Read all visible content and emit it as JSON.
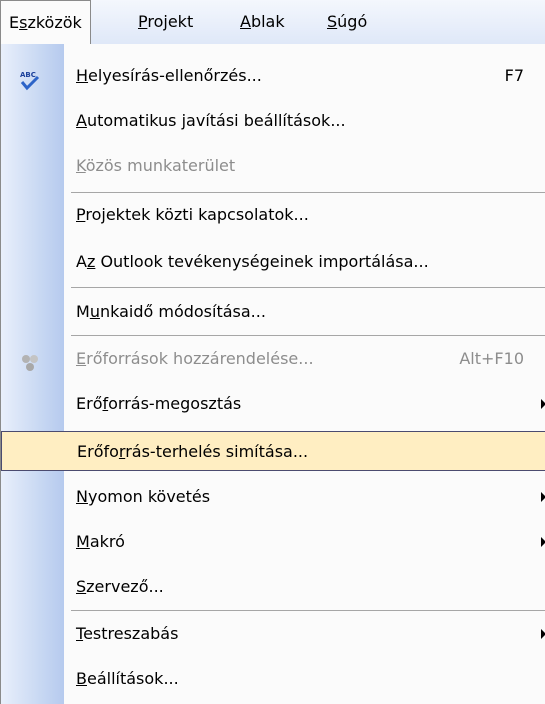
{
  "menubar": {
    "items": [
      {
        "label": "Eszközök",
        "prefix": "E",
        "ul": "s",
        "suffix": "zközök",
        "active": true
      },
      {
        "label": "Projekt",
        "prefix": "",
        "ul": "P",
        "suffix": "rojekt",
        "active": false
      },
      {
        "label": "Ablak",
        "prefix": "",
        "ul": "A",
        "suffix": "blak",
        "active": false
      },
      {
        "label": "Súgó",
        "prefix": "",
        "ul": "S",
        "suffix": "úgó",
        "active": false
      }
    ]
  },
  "menu": {
    "items": [
      {
        "label": "Helyesírás-ellenőrzés...",
        "prefix": "",
        "ul": "H",
        "suffix": "elyesírás-ellenőrzés...",
        "shortcut": "F7",
        "icon": "spellcheck-icon"
      },
      {
        "label": "Automatikus javítási beállítások...",
        "prefix": "",
        "ul": "A",
        "suffix": "utomatikus javítási beállítások..."
      },
      {
        "label": "Közös munkaterület",
        "prefix": "",
        "ul": "K",
        "suffix": "özös munkaterület",
        "disabled": true
      },
      {
        "label": "Projektek közti kapcsolatok...",
        "prefix": "",
        "ul": "P",
        "suffix": "rojektek közti kapcsolatok..."
      },
      {
        "label": "Az Outlook tevékenységeinek importálása...",
        "prefix": "A",
        "ul": "z",
        "suffix": " Outlook tevékenységeinek importálása..."
      },
      {
        "label": "Munkaidő módosítása...",
        "prefix": "M",
        "ul": "u",
        "suffix": "nkaidő módosítása..."
      },
      {
        "label": "Erőforrások hozzárendelése...",
        "prefix": "",
        "ul": "E",
        "suffix": "rőforrások hozzárendelése...",
        "shortcut": "Alt+F10",
        "disabled": true,
        "icon": "resources-icon"
      },
      {
        "label": "Erőforrás-megosztás",
        "prefix": "Erő",
        "ul": "f",
        "suffix": "orrás-megosztás",
        "submenu": true
      },
      {
        "label": "Erőforrás-terhelés simítása...",
        "prefix": "Erőfo",
        "ul": "r",
        "suffix": "rás-terhelés simítása...",
        "highlight": true
      },
      {
        "label": "Nyomon követés",
        "prefix": "",
        "ul": "N",
        "suffix": "yomon követés",
        "submenu": true
      },
      {
        "label": "Makró",
        "prefix": "",
        "ul": "M",
        "suffix": "akró",
        "submenu": true
      },
      {
        "label": "Szervező...",
        "prefix": "",
        "ul": "S",
        "suffix": "zervező..."
      },
      {
        "label": "Testreszabás",
        "prefix": "",
        "ul": "T",
        "suffix": "estreszabás",
        "submenu": true
      },
      {
        "label": "Beállítások...",
        "prefix": "",
        "ul": "B",
        "suffix": "eállítások..."
      }
    ]
  }
}
